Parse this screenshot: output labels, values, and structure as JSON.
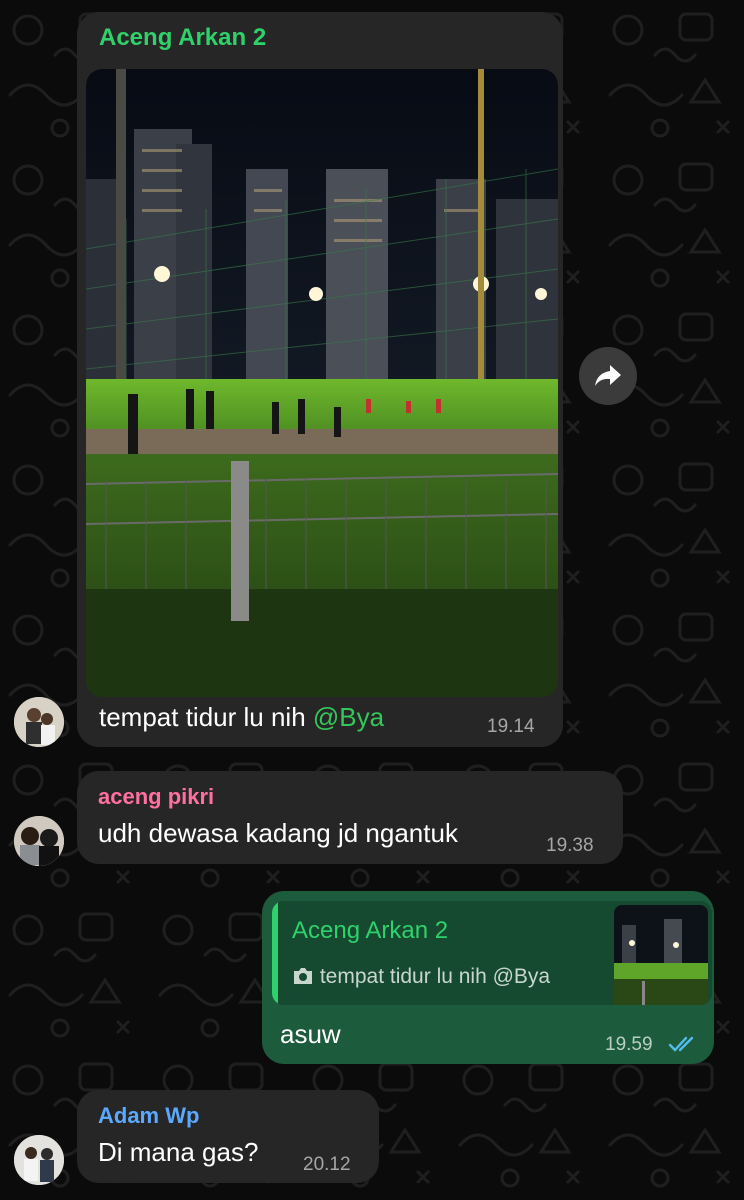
{
  "colors": {
    "background": "#0b0b0b",
    "incoming_bubble": "#262626",
    "outgoing_bubble": "#1d5b3d",
    "quote_bar": "#2fd16b",
    "read_ticks": "#53bdeb"
  },
  "messages": [
    {
      "sender": "Aceng Arkan 2",
      "sender_color": "#2fd16b",
      "has_image": true,
      "text": "tempat tidur lu nih ",
      "mention": "@Bya",
      "time": "19.14",
      "icons": [
        "forward-icon"
      ]
    },
    {
      "sender": "aceng pikri",
      "sender_color": "#ff6fa0",
      "text": "udh dewasa kadang jd ngantuk",
      "time": "19.38"
    },
    {
      "outgoing": true,
      "reply": {
        "sender": "Aceng Arkan 2",
        "text": "tempat tidur lu nih ",
        "mention": "@Bya",
        "icon": "camera-icon"
      },
      "text": "asuw",
      "time": "19.59",
      "status_icon": "double-check-icon"
    },
    {
      "sender": "Adam Wp",
      "sender_color": "#5aa9ff",
      "text": "Di mana gas?",
      "time": "20.12"
    }
  ]
}
